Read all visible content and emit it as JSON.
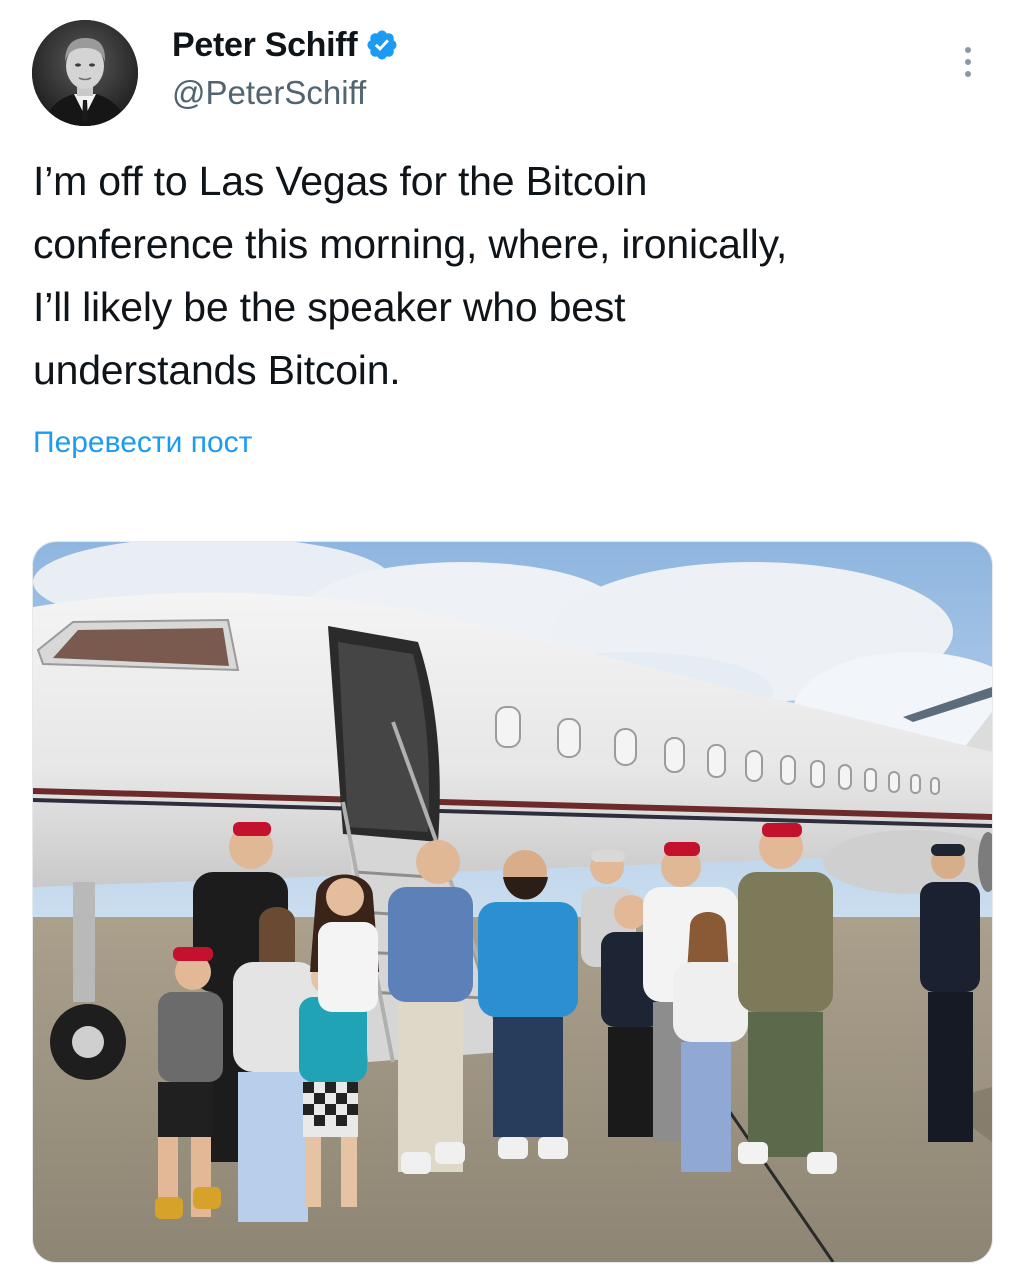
{
  "tweet": {
    "author": {
      "display_name": "Peter Schiff",
      "handle": "@PeterSchiff",
      "verified": true,
      "verified_color": "#1d9bf0"
    },
    "text": "I’m off to Las Vegas for the Bitcoin\nconference this morning, where, ironically,\nI’ll likely be the speaker who best\nunderstands Bitcoin.",
    "translate_label": "Перевести пост",
    "accent_color": "#1d9bf0",
    "icons": {
      "more": "more-vertical-icon",
      "verified": "verified-badge-icon"
    },
    "media": {
      "type": "photo"
    }
  }
}
